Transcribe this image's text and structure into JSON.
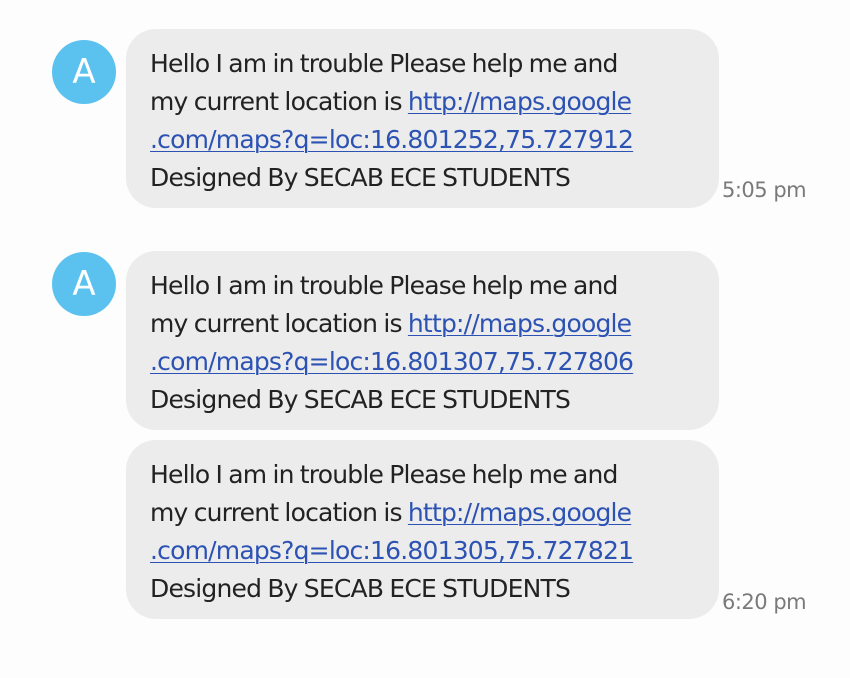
{
  "contact": {
    "avatar_letter": "A",
    "avatar_color": "#5bc2ef"
  },
  "messages": [
    {
      "text_before_link": "Hello I am in trouble Please help me and",
      "text_location": "my current location is ",
      "link_part1": "http://maps.google",
      "link_part2": ".com/maps?q=loc:16.801252,75.727912",
      "footer": "Designed By SECAB ECE STUDENTS",
      "time": "5:05 pm"
    },
    {
      "text_before_link": "Hello I am in trouble Please help me and",
      "text_location": "my current location is ",
      "link_part1": "http://maps.google",
      "link_part2": ".com/maps?q=loc:16.801307,75.727806",
      "footer": "Designed By SECAB ECE STUDENTS",
      "time": ""
    },
    {
      "text_before_link": "Hello I am in trouble Please help me and",
      "text_location": "my current location is ",
      "link_part1": "http://maps.google",
      "link_part2": ".com/maps?q=loc:16.801305,75.727821",
      "footer": "Designed By SECAB ECE STUDENTS",
      "time": "6:20 pm"
    }
  ],
  "colors": {
    "bubble_bg": "#ececec",
    "link": "#2c52b4",
    "timestamp": "#7a7a7a"
  }
}
